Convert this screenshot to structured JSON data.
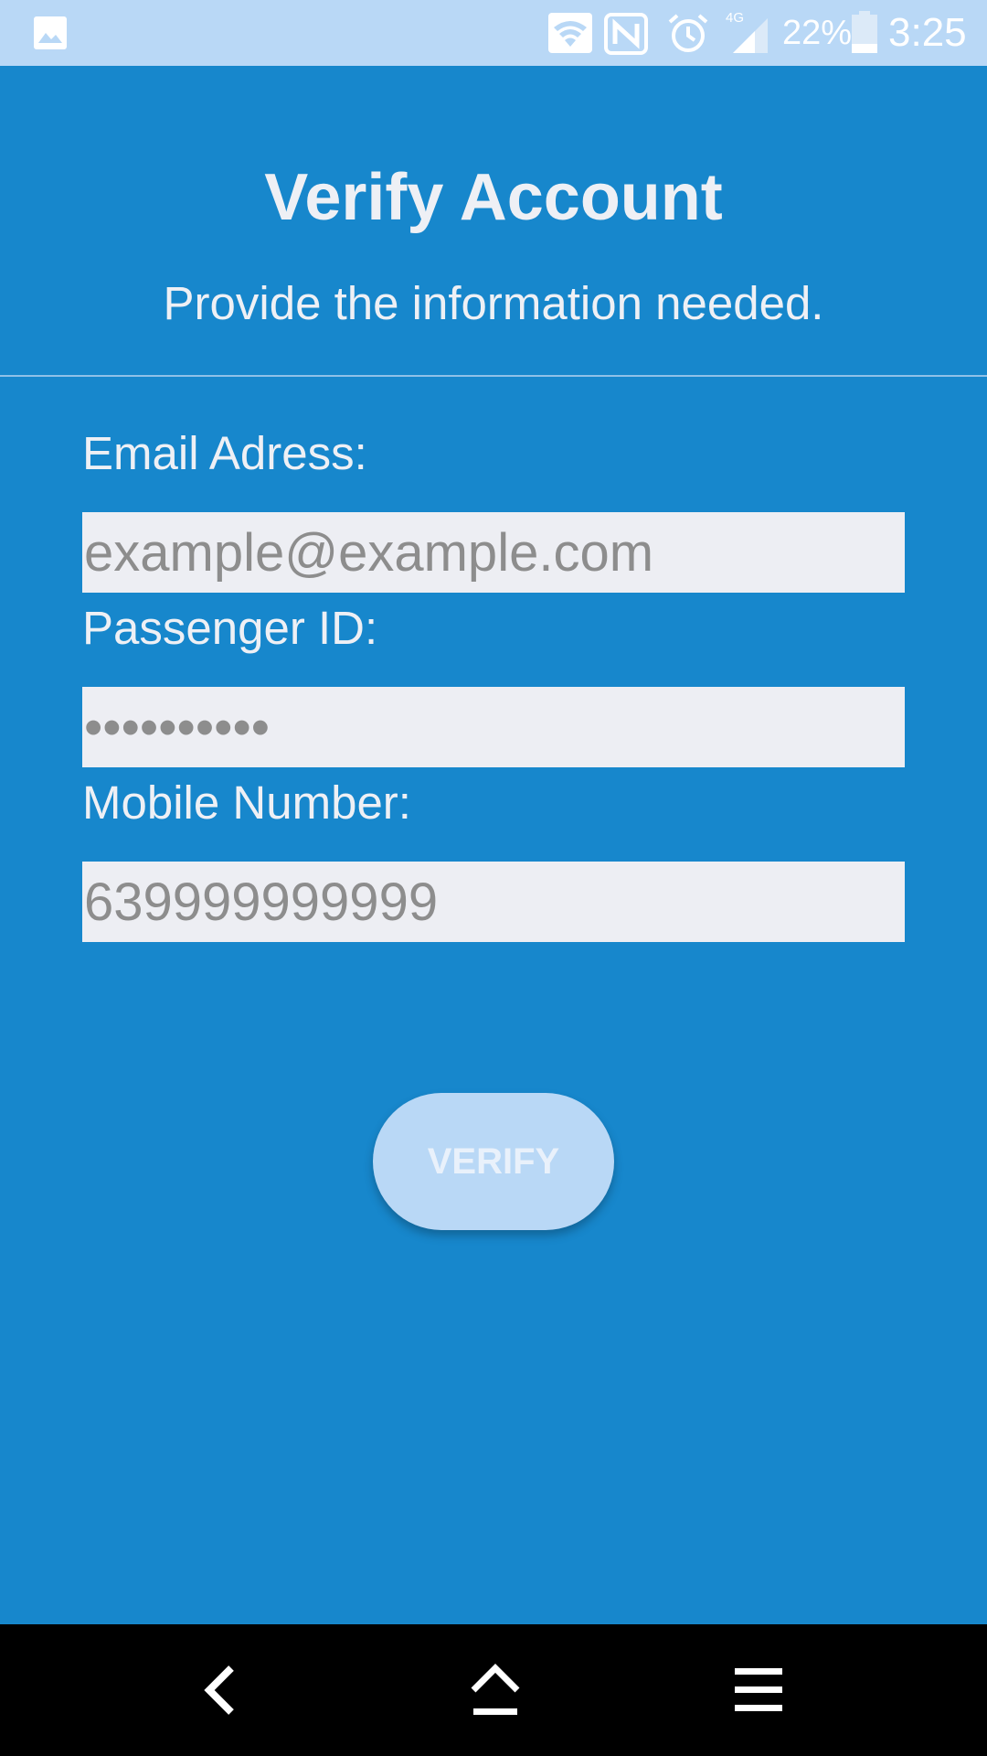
{
  "status_bar": {
    "battery_percent": "22%",
    "time": "3:25",
    "network_label": "4G",
    "icons": [
      "gallery-icon",
      "wifi-icon",
      "nfc-icon",
      "alarm-icon",
      "signal-icon",
      "battery-icon"
    ]
  },
  "header": {
    "title": "Verify Account",
    "subtitle": "Provide the information needed."
  },
  "form": {
    "email": {
      "label": "Email Adress:",
      "placeholder": "example@example.com",
      "value": ""
    },
    "passenger_id": {
      "label": "Passenger ID:",
      "placeholder": "••••••••••",
      "value": ""
    },
    "mobile": {
      "label": "Mobile Number:",
      "placeholder": "639999999999",
      "value": ""
    },
    "verify_label": "VERIFY"
  },
  "nav_bar": {
    "icons": [
      "back-icon",
      "home-icon",
      "menu-icon"
    ]
  },
  "colors": {
    "background": "#1787cc",
    "status_bar": "#b9d8f6",
    "input_background": "#edeef3",
    "button_background": "#b9d8f6",
    "text_light": "#eef0f5",
    "placeholder": "#8d8d8d"
  }
}
